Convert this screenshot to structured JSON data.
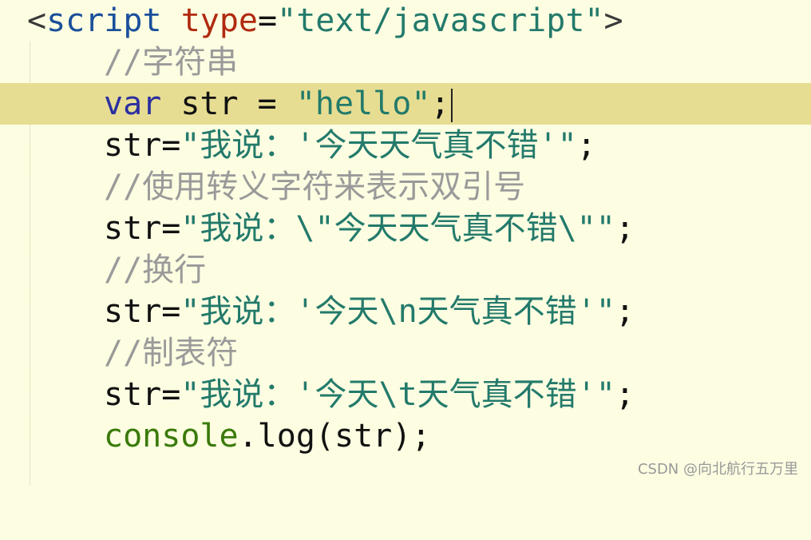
{
  "code": {
    "line1": {
      "lt": "<",
      "tag": "script",
      "space": " ",
      "attr": "type",
      "eq": "=",
      "value": "\"text/javascript\"",
      "gt": ">"
    },
    "line2": {
      "comment": "//字符串"
    },
    "line3": {
      "keyword": "var",
      "rest": " str = ",
      "string": "\"hello\"",
      "semi": ";"
    },
    "line4": {
      "ident": "str",
      "eq": "=",
      "string": "\"我说：'今天天气真不错'\"",
      "semi": ";"
    },
    "line5": {
      "comment": "//使用转义字符来表示双引号"
    },
    "line6": {
      "ident": "str",
      "eq": "=",
      "string": "\"我说：\\\"今天天气真不错\\\"\"",
      "semi": ";"
    },
    "line7": {
      "comment": "//换行"
    },
    "line8": {
      "ident": "str",
      "eq": "=",
      "string": "\"我说：'今天\\n天气真不错'\"",
      "semi": ";"
    },
    "line9": {
      "comment": "//制表符"
    },
    "line10": {
      "ident": "str",
      "eq": "=",
      "string": "\"我说：'今天\\t天气真不错'\"",
      "semi": ";"
    },
    "line11": {
      "fn": "console",
      "rest": ".log(str);"
    }
  },
  "watermark": "CSDN @向北航行五万里"
}
